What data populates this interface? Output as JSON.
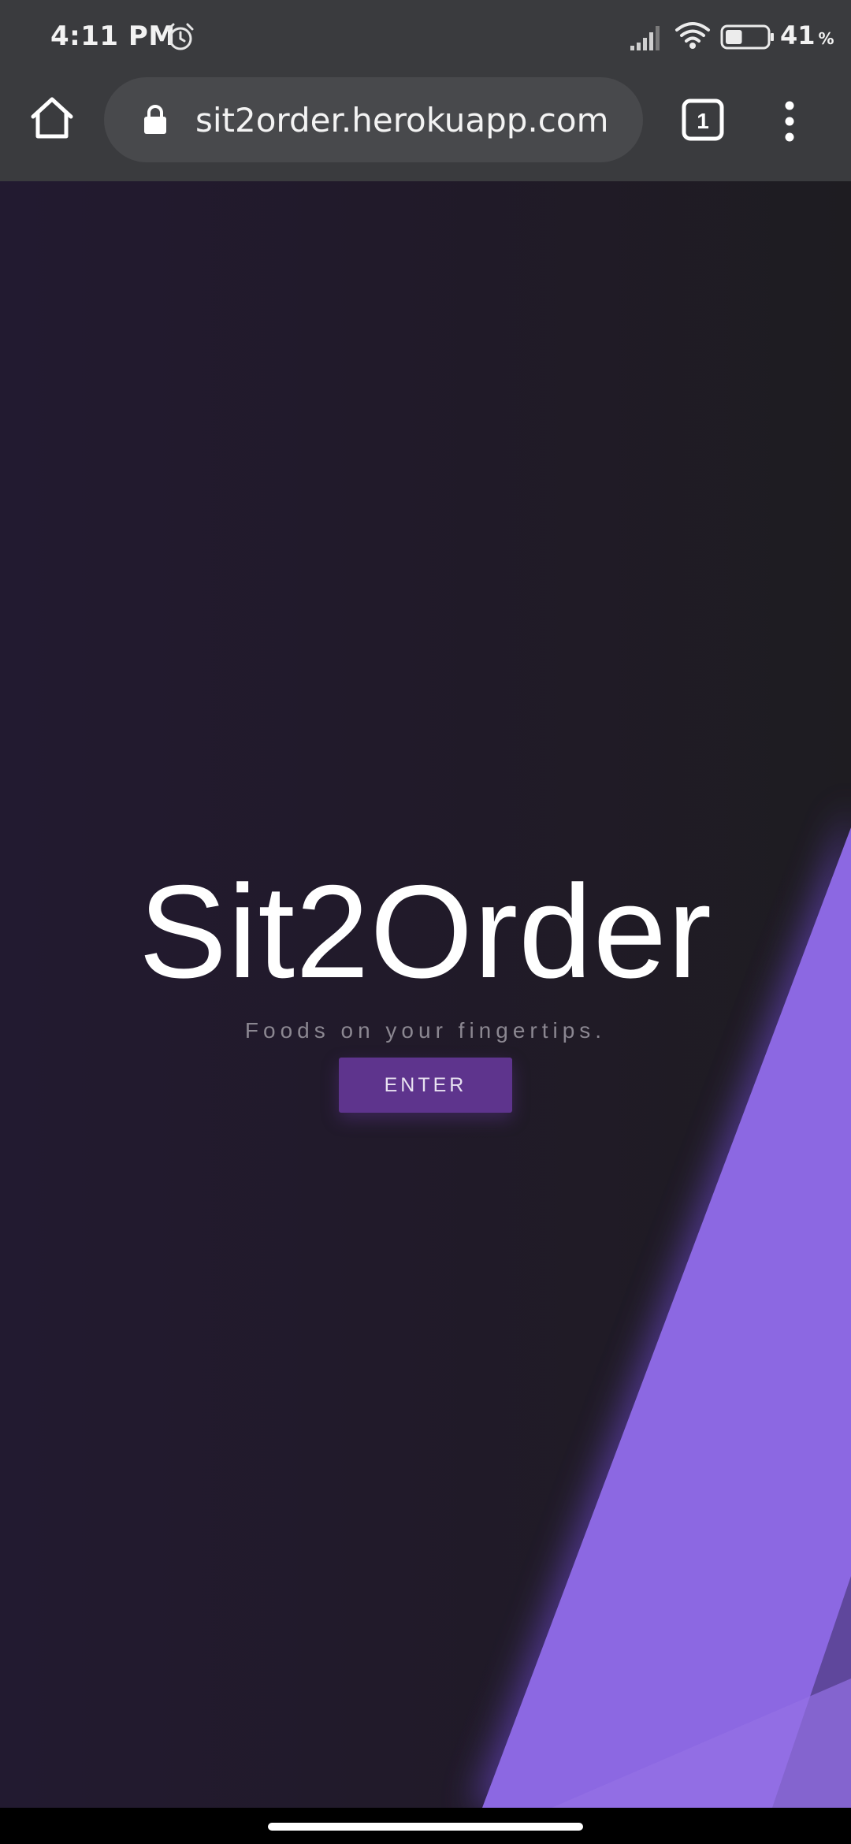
{
  "status_bar": {
    "time": "4:11 PM",
    "battery_percent": "41",
    "battery_unit": "%",
    "battery_level": 0.41,
    "icons": [
      "alarm-icon",
      "signal-icon",
      "wifi-icon",
      "battery-icon"
    ]
  },
  "browser": {
    "url": "sit2order.herokuapp.com",
    "tab_count": "1",
    "icons": [
      "home-icon",
      "lock-icon",
      "tabs-icon",
      "more-vert-icon"
    ]
  },
  "hero": {
    "title": "Sit2Order",
    "tagline": "Foods on your fingertips.",
    "enter_label": "ENTER",
    "colors": {
      "background": "#211a2a",
      "accent": "#8f6be3",
      "button": "#5e348d"
    }
  }
}
